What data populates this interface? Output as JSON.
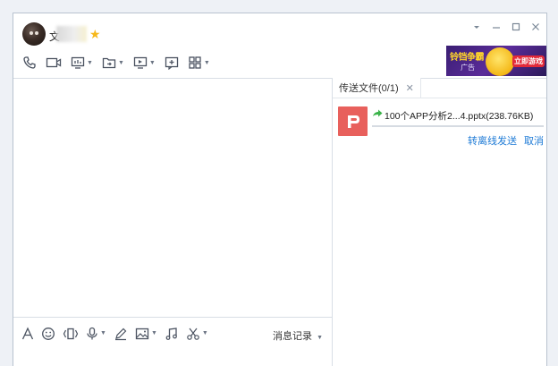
{
  "header": {
    "contact_name_visible": "文",
    "status_icon": "star-icon"
  },
  "window_controls": [
    "dropdown",
    "minimize",
    "maximize",
    "close"
  ],
  "toolbar": {
    "items": [
      "phone-icon",
      "video-call-icon",
      "share-screen-icon",
      "send-file-icon",
      "remote-desktop-icon",
      "add-app-icon",
      "apps-grid-icon"
    ]
  },
  "ad": {
    "title": "铃铛争霸",
    "sublabel": "广告",
    "button": "立即游戏"
  },
  "side_panel": {
    "tab_label": "传送文件(0/1)",
    "file": {
      "name": "100个APP分析2...4.pptx(238.76KB)",
      "progress": 0,
      "icon": "powerpoint-icon",
      "icon_color": "#e8605c",
      "actions": {
        "offline_send": "转离线发送",
        "cancel": "取消"
      }
    }
  },
  "input_toolbar": {
    "items": [
      "font-icon",
      "emoji-icon",
      "shake-icon",
      "voice-icon",
      "handwrite-icon",
      "image-icon",
      "music-icon",
      "screenshot-icon"
    ],
    "history_label": "消息记录"
  },
  "colors": {
    "link": "#1f7bd6",
    "accent": "#12b7f5",
    "star": "#f6b81a"
  }
}
